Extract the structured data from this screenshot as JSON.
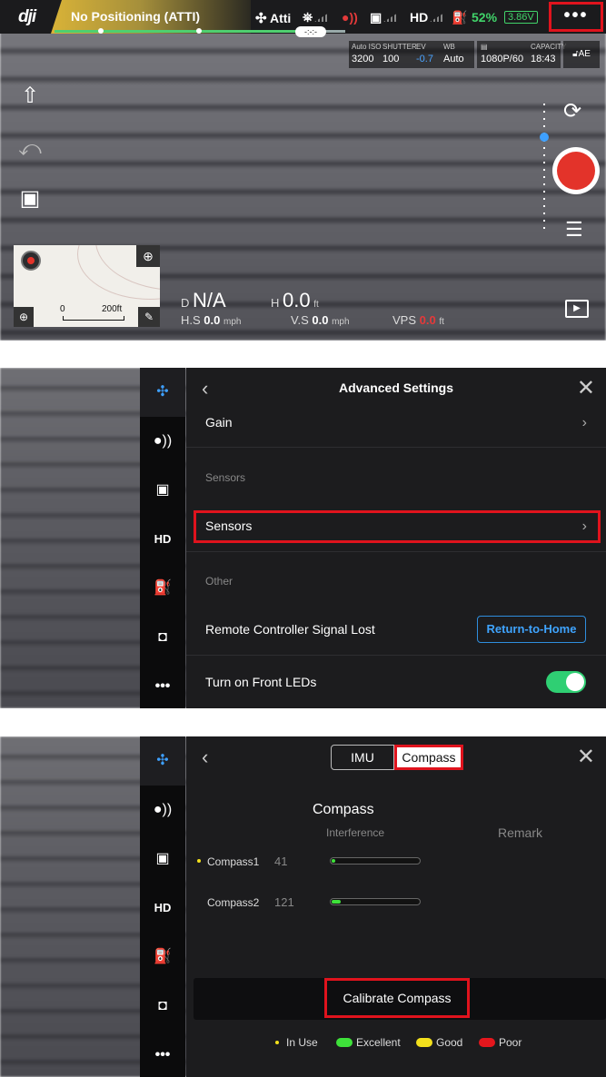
{
  "status_bar": {
    "logo": "dji",
    "flight_mode": "No Positioning (ATTI)",
    "atti_label": "Atti",
    "gps_tag": "-:-:-",
    "hd_label": "HD",
    "battery_percent": "52%",
    "battery_voltage": "3.86V",
    "more_label": "•••"
  },
  "camera_params": {
    "iso_label": "Auto ISO",
    "iso_value": "3200",
    "shutter_label": "SHUTTER",
    "shutter_value": "100",
    "ev_label": "EV",
    "ev_value": "-0.7",
    "wb_label": "WB",
    "wb_value": "Auto",
    "format_value": "1080P/60",
    "capacity_label": "CAPACITY",
    "capacity_value": "18:43",
    "ae_label": "AE"
  },
  "map": {
    "scale_zero": "0",
    "scale_label": "200ft"
  },
  "telemetry": {
    "d_label": "D",
    "d_value": "N/A",
    "h_label": "H",
    "h_value": "0.0",
    "h_unit": "ft",
    "hs_label": "H.S",
    "hs_value": "0.0",
    "hs_unit": "mph",
    "vs_label": "V.S",
    "vs_value": "0.0",
    "vs_unit": "mph",
    "vps_label": "VPS",
    "vps_value": "0.0",
    "vps_unit": "ft"
  },
  "sidebar": {
    "hd_label": "HD",
    "more_label": "•••"
  },
  "advanced": {
    "title": "Advanced Settings",
    "gain_label": "Gain",
    "sensors_section": "Sensors",
    "sensors_label": "Sensors",
    "other_section": "Other",
    "rc_signal_lost_label": "Remote Controller Signal Lost",
    "rc_signal_lost_value": "Return-to-Home",
    "front_leds_label": "Turn on Front LEDs"
  },
  "compass": {
    "tab_imu": "IMU",
    "tab_compass": "Compass",
    "heading": "Compass",
    "col_interference": "Interference",
    "col_remark": "Remark",
    "rows": [
      {
        "name": "Compass1",
        "value": "41",
        "level": 0.03
      },
      {
        "name": "Compass2",
        "value": "121",
        "level": 0.1
      }
    ],
    "calibrate_label": "Calibrate Compass",
    "legend": {
      "in_use": "In Use",
      "excellent": "Excellent",
      "good": "Good",
      "poor": "Poor"
    }
  },
  "colors": {
    "accent_blue": "#3ea0ff",
    "record_red": "#e3332a",
    "excellent": "#3ee13a",
    "good": "#f3e01c",
    "poor": "#e5161d",
    "highlight": "#e0131d"
  }
}
